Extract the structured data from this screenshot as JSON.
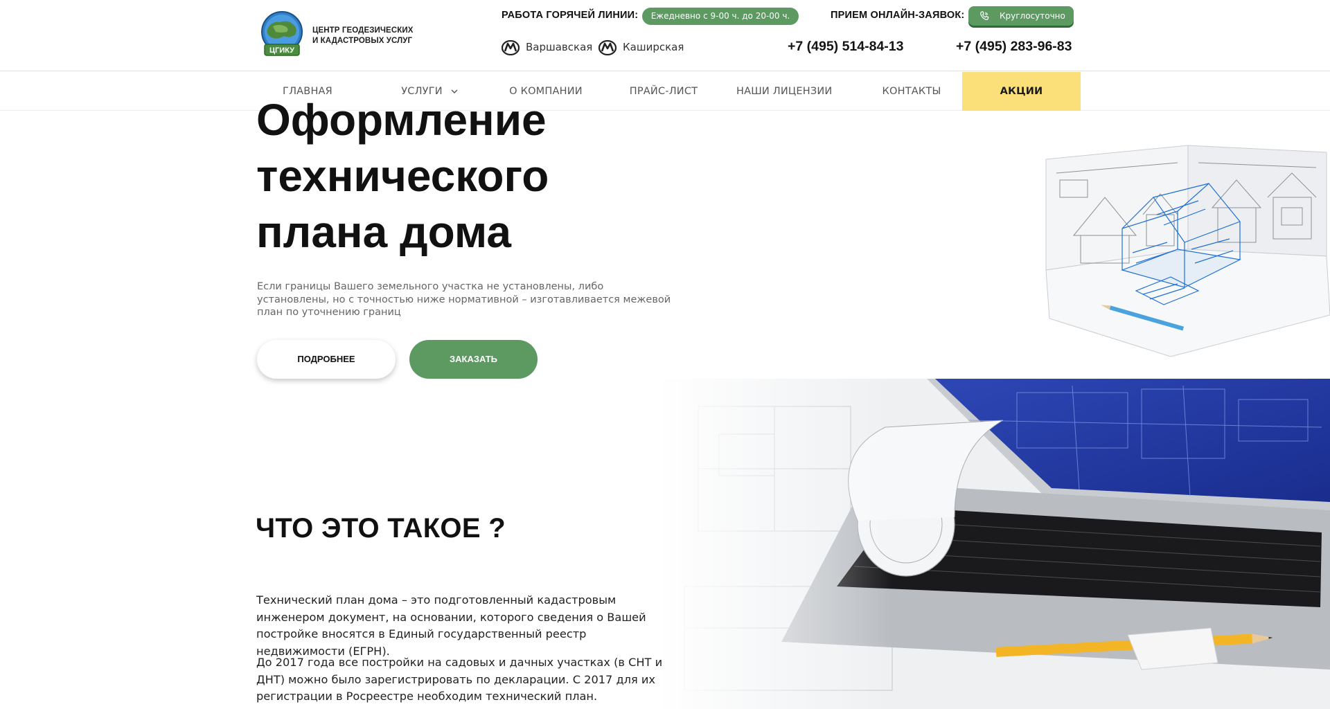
{
  "header": {
    "logo": {
      "badge_text": "ЦГИКУ",
      "line1": "ЦЕНТР ГЕОДЕЗИЧЕСКИХ",
      "line2": "И КАДАСТРОВЫХ УСЛУГ"
    },
    "hotline": {
      "label": "РАБОТА ГОРЯЧЕЙ ЛИНИИ:",
      "hours": "Ежедневно с 9-00 ч. до 20-00 ч."
    },
    "online": {
      "label": "ПРИЕМ ОНЛАЙН-ЗАЯВОК:",
      "hours": "Круглосуточно",
      "icon": "phone-icon"
    },
    "metro": [
      {
        "name": "Варшавская",
        "icon": "metro-icon"
      },
      {
        "name": "Каширская",
        "icon": "metro-icon"
      }
    ],
    "phones": [
      "+7 (495) 514-84-13",
      "+7 (495) 283-96-83"
    ]
  },
  "nav": {
    "items": [
      {
        "label": "Главная"
      },
      {
        "label": "Услуги",
        "icon": "chevron-down-icon"
      },
      {
        "label": "О компании"
      },
      {
        "label": "Прайс-лист"
      },
      {
        "label": "Наши лицензии"
      },
      {
        "label": "Контакты"
      },
      {
        "label": "Акции"
      }
    ],
    "highlight_color": "#fbe07a"
  },
  "hero": {
    "title_lines": [
      "Оформление",
      "технического",
      "плана дома"
    ],
    "subtitle": "Если границы Вашего земельного участка не установлены, либо установлены, но с точностью ниже нормативной – изготавливается межевой план по уточнению границ",
    "btn_more": "ПОДРОБНЕЕ",
    "btn_order": "ЗАКАЗАТЬ",
    "accent_color": "#5c9a62"
  },
  "about": {
    "title": "ЧТО ЭТО ТАКОЕ ?",
    "paragraphs": [
      "Технический план дома – это подготовленный кадастровым инженером документ, на основании, которого сведения о Вашей постройке вносятся в Единый государственный реестр недвижимости (ЕГРН).",
      "До 2017 года все постройки на садовых и дачных участках (в СНТ и ДНТ) можно было зарегистрировать по декларации. С 2017 для их регистрации в Росреестре необходим технический план."
    ]
  }
}
